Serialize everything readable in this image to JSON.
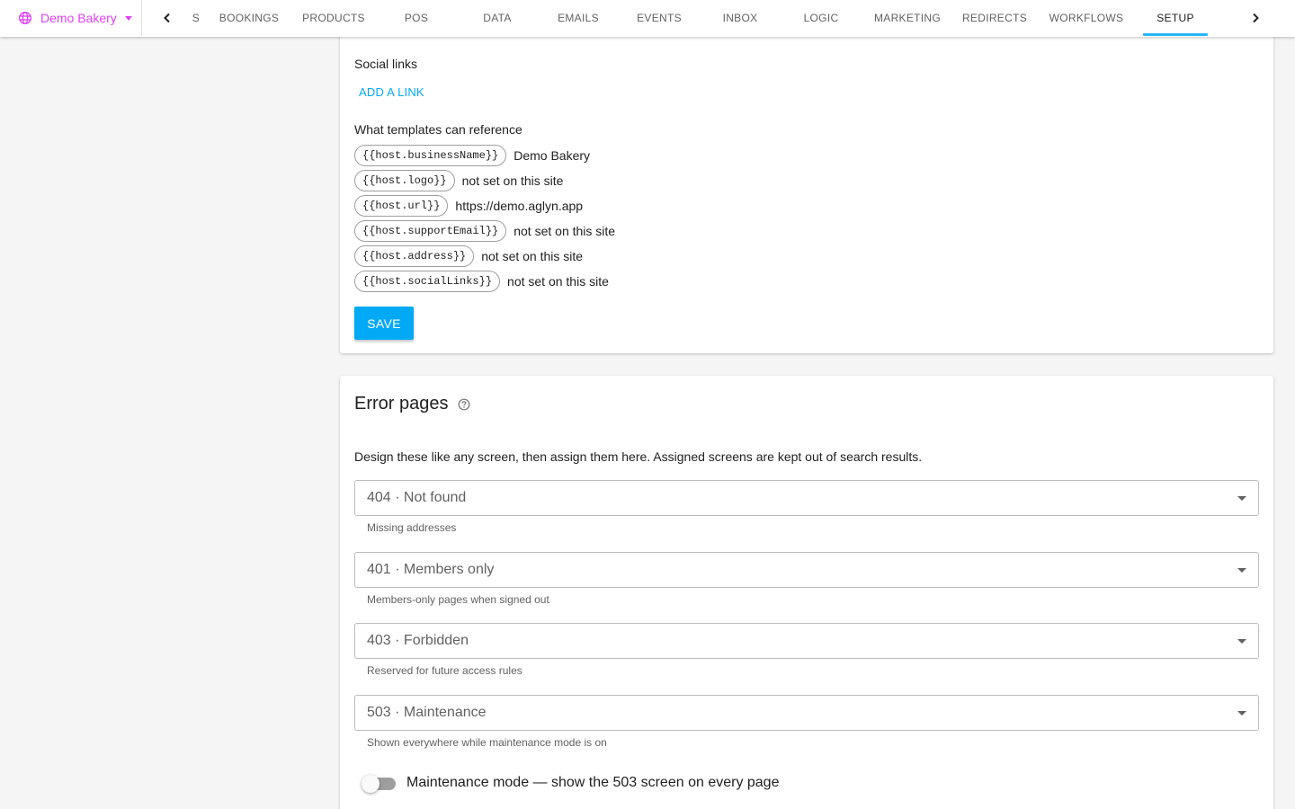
{
  "header": {
    "site_name": "Demo Bakery",
    "tabs_left_partial": "S",
    "tabs": [
      {
        "label": "BOOKINGS"
      },
      {
        "label": "PRODUCTS"
      },
      {
        "label": "POS"
      },
      {
        "label": "DATA"
      },
      {
        "label": "EMAILS"
      },
      {
        "label": "EVENTS"
      },
      {
        "label": "INBOX"
      },
      {
        "label": "LOGIC"
      },
      {
        "label": "MARKETING"
      },
      {
        "label": "REDIRECTS"
      },
      {
        "label": "WORKFLOWS"
      },
      {
        "label": "SETUP"
      }
    ],
    "active_tab": "SETUP"
  },
  "host_card": {
    "social_links_label": "Social links",
    "add_link_label": "ADD A LINK",
    "templates_label": "What templates can reference",
    "references": [
      {
        "token": "{{host.businessName}}",
        "value": "Demo Bakery"
      },
      {
        "token": "{{host.logo}}",
        "value": "not set on this site"
      },
      {
        "token": "{{host.url}}",
        "value": "https://demo.aglyn.app"
      },
      {
        "token": "{{host.supportEmail}}",
        "value": "not set on this site"
      },
      {
        "token": "{{host.address}}",
        "value": "not set on this site"
      },
      {
        "token": "{{host.socialLinks}}",
        "value": "not set on this site"
      }
    ],
    "save_label": "SAVE"
  },
  "error_pages": {
    "title": "Error pages",
    "description": "Design these like any screen, then assign them here. Assigned screens are kept out of search results.",
    "selects": [
      {
        "value": "404 · Not found",
        "hint": "Missing addresses"
      },
      {
        "value": "401 · Members only",
        "hint": "Members-only pages when signed out"
      },
      {
        "value": "403 · Forbidden",
        "hint": "Reserved for future access rules"
      },
      {
        "value": "503 · Maintenance",
        "hint": "Shown everywhere while maintenance mode is on"
      }
    ],
    "maintenance_toggle_label": "Maintenance mode — show the 503 screen on every page",
    "maintenance_on": false
  },
  "colors": {
    "accent": "#03a9f4",
    "site_name": "#e040fb",
    "tab_indicator": "#29b6f6"
  }
}
